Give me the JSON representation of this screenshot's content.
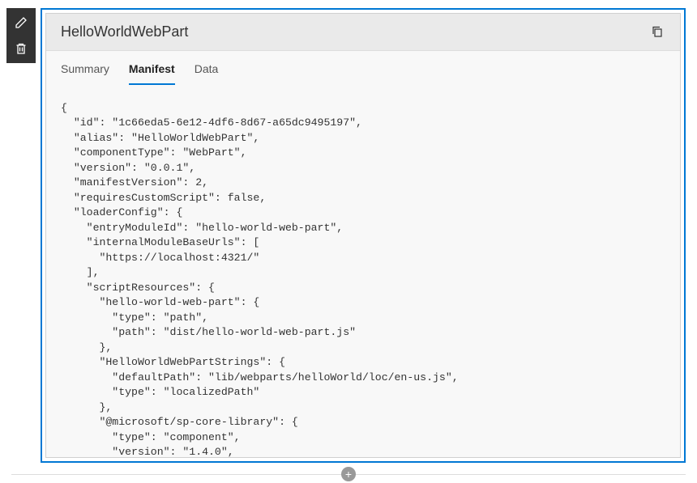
{
  "toolbar": {
    "edit_label": "Edit",
    "delete_label": "Delete"
  },
  "panel": {
    "title": "HelloWorldWebPart",
    "copy_label": "Copy"
  },
  "tabs": [
    {
      "label": "Summary",
      "active": false
    },
    {
      "label": "Manifest",
      "active": true
    },
    {
      "label": "Data",
      "active": false
    }
  ],
  "manifest_code": "{\n  \"id\": \"1c66eda5-6e12-4df6-8d67-a65dc9495197\",\n  \"alias\": \"HelloWorldWebPart\",\n  \"componentType\": \"WebPart\",\n  \"version\": \"0.0.1\",\n  \"manifestVersion\": 2,\n  \"requiresCustomScript\": false,\n  \"loaderConfig\": {\n    \"entryModuleId\": \"hello-world-web-part\",\n    \"internalModuleBaseUrls\": [\n      \"https://localhost:4321/\"\n    ],\n    \"scriptResources\": {\n      \"hello-world-web-part\": {\n        \"type\": \"path\",\n        \"path\": \"dist/hello-world-web-part.js\"\n      },\n      \"HelloWorldWebPartStrings\": {\n        \"defaultPath\": \"lib/webparts/helloWorld/loc/en-us.js\",\n        \"type\": \"localizedPath\"\n      },\n      \"@microsoft/sp-core-library\": {\n        \"type\": \"component\",\n        \"version\": \"1.4.0\",",
  "add_label": "+"
}
